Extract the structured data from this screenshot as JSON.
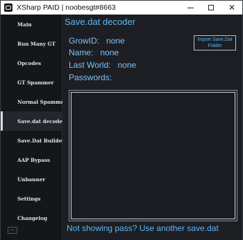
{
  "window": {
    "title": "XSharp PAID | noobesgt#8663",
    "minimize_glyph": "",
    "close_glyph": "✕"
  },
  "sidebar": {
    "items": [
      {
        "label": "Main",
        "active": false
      },
      {
        "label": "Run Many GT",
        "active": false
      },
      {
        "label": "Opcodes",
        "active": false
      },
      {
        "label": "GT Spammer",
        "active": false
      },
      {
        "label": "Normal Spammer",
        "active": false
      },
      {
        "label": "Save.dat decoder",
        "active": true
      },
      {
        "label": "Save.Dat Builder",
        "active": false
      },
      {
        "label": "AAP Bypass",
        "active": false
      },
      {
        "label": "Unbanner",
        "active": false
      },
      {
        "label": "Settings",
        "active": false
      },
      {
        "label": "Changelog",
        "active": false
      }
    ],
    "footer_icon": "keyboard-icon"
  },
  "main": {
    "title": "Save.dat decoder",
    "growid_label": "GrowID:",
    "growid_value": "none",
    "name_label": "Name:",
    "name_value": "none",
    "last_world_label": "Last World:",
    "last_world_value": "none",
    "passwords_label": "Passwords:",
    "import_button_label": "Import Save.Dat Folder",
    "footer_note": "Not showing pass? Use another save.dat"
  },
  "colors": {
    "accent": "#5fb6f4",
    "background": "#1c1e23",
    "sidebar": "#14161a"
  }
}
